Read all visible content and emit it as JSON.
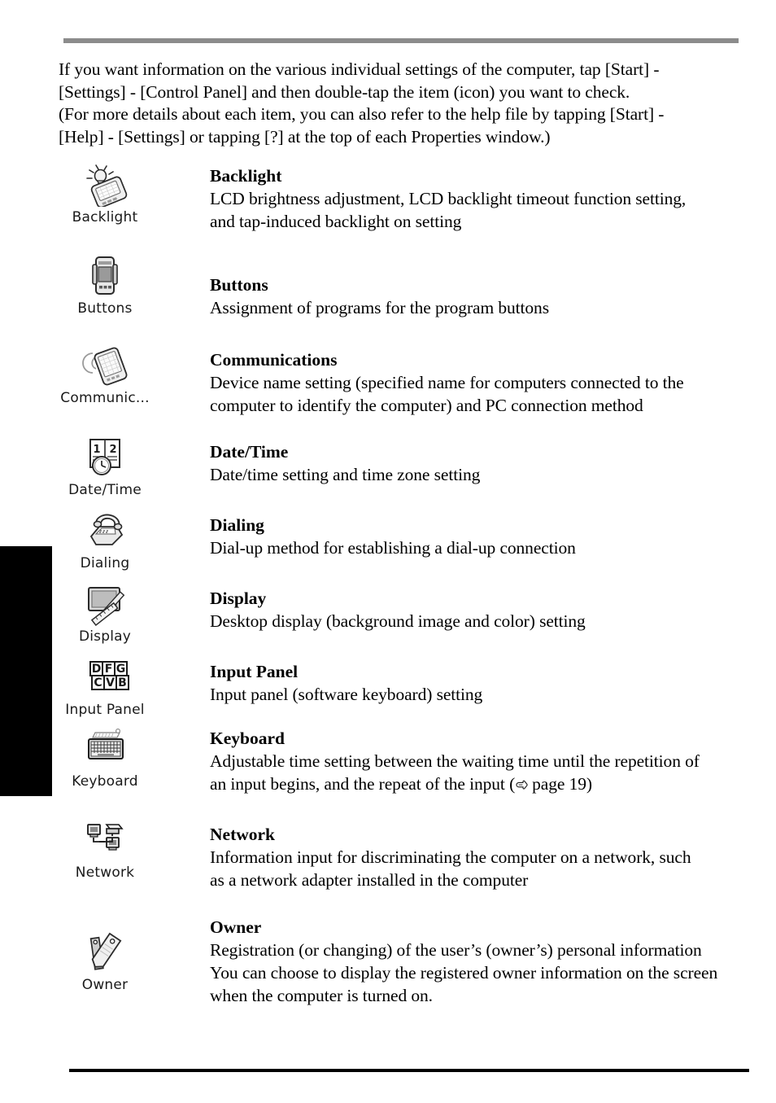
{
  "page": {
    "intro_lines": [
      "If you want information on the various individual settings of the computer, tap [Start] -",
      "[Settings] - [Control Panel] and then double-tap the item (icon) you want to check.",
      "(For more details about each item, you can also refer to the help file by tapping [Start] -",
      "[Help] - [Settings] or tapping [?] at the top of each Properties window.)"
    ],
    "rule_color_top": "#8c8c8c",
    "rule_color_bottom": "#000000",
    "tab_color": "#000000"
  },
  "settings": [
    {
      "icon_name": "backlight-icon",
      "icon_label": "Backlight",
      "title": "Backlight",
      "desc_lines": [
        "LCD brightness adjustment, LCD backlight timeout function setting,",
        "and tap-induced backlight on setting"
      ]
    },
    {
      "icon_name": "buttons-icon",
      "icon_label": "Buttons",
      "title": "Buttons",
      "desc_lines": [
        "Assignment of programs for the program buttons"
      ]
    },
    {
      "icon_name": "communications-icon",
      "icon_label": "Communic...",
      "title": "Communications",
      "desc_lines": [
        "Device name setting (specified name for computers connected to the",
        "computer to identify the computer) and PC connection method"
      ]
    },
    {
      "icon_name": "date-time-icon",
      "icon_label": "Date/Time",
      "title": "Date/Time",
      "desc_lines": [
        "Date/time setting and time zone setting"
      ]
    },
    {
      "icon_name": "dialing-icon",
      "icon_label": "Dialing",
      "title": "Dialing",
      "desc_lines": [
        "Dial-up method for establishing a dial-up connection"
      ]
    },
    {
      "icon_name": "display-icon",
      "icon_label": "Display",
      "title": "Display",
      "desc_lines": [
        "Desktop display (background image and color) setting"
      ]
    },
    {
      "icon_name": "input-panel-icon",
      "icon_label": "Input Panel",
      "title": "Input Panel",
      "desc_lines": [
        "Input panel (software keyboard) setting"
      ]
    },
    {
      "icon_name": "keyboard-icon",
      "icon_label": "Keyboard",
      "title": "Keyboard",
      "desc_lines": [
        "Adjustable time setting between the waiting time until the repetition of",
        "an input begins, and the repeat of the input ("
      ],
      "cross_reference": "page 19)"
    },
    {
      "icon_name": "network-icon",
      "icon_label": "Network",
      "title": "Network",
      "desc_lines": [
        "Information input for discriminating the computer on a network, such",
        "as a network adapter installed in the computer"
      ]
    },
    {
      "icon_name": "owner-icon",
      "icon_label": "Owner",
      "title": "Owner",
      "desc_lines": [
        "Registration (or changing) of the user’s (owner’s) personal information",
        "You can choose to display the registered owner information on the screen",
        "when the computer is turned on."
      ]
    }
  ]
}
